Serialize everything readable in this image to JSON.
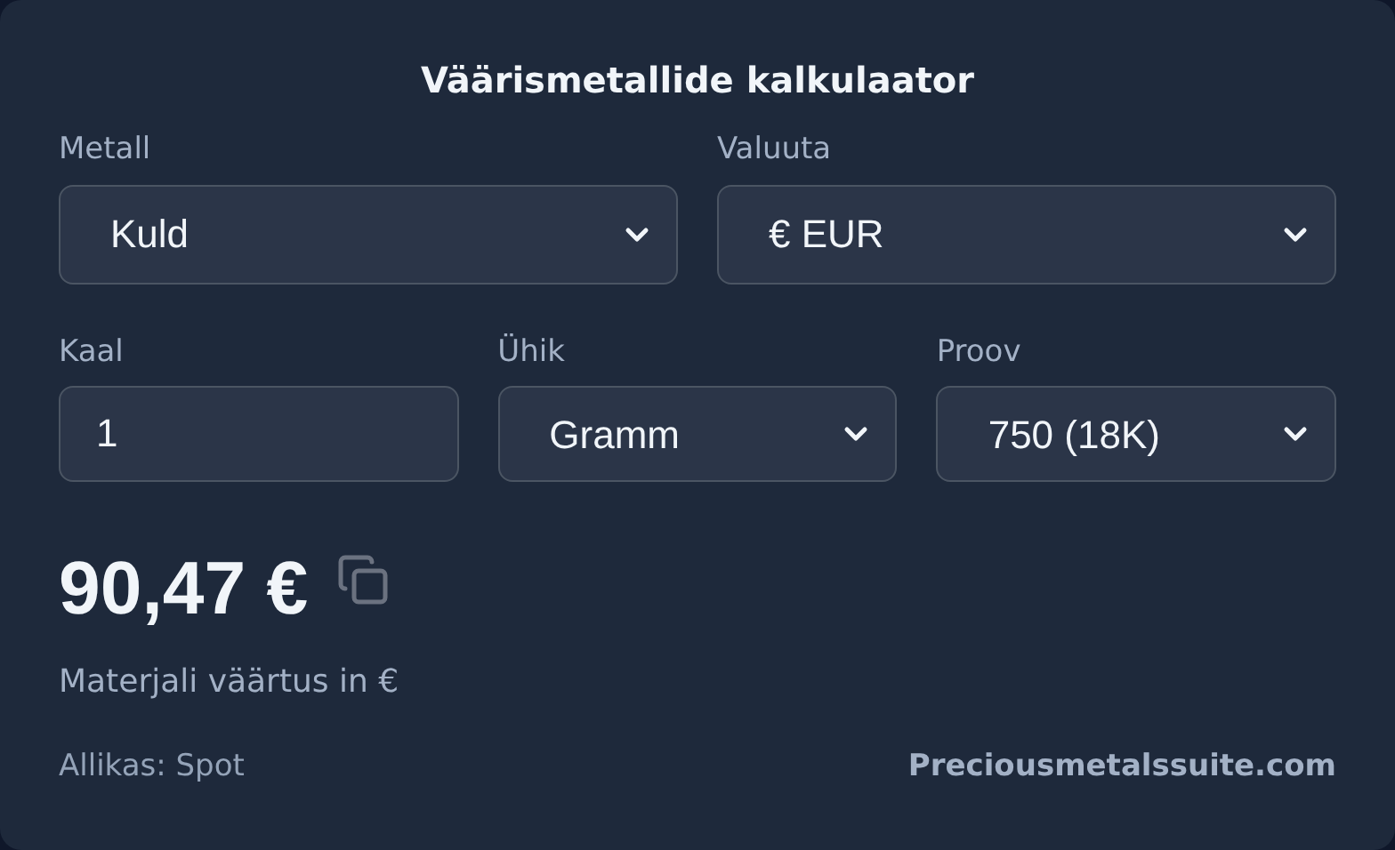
{
  "title": "Väärismetallide kalkulaator",
  "top_fields": [
    {
      "label": "Metall",
      "kind": "select",
      "value": "Kuld"
    },
    {
      "label": "Valuuta",
      "kind": "select",
      "value": "€ EUR"
    }
  ],
  "bottom_fields": [
    {
      "label": "Kaal",
      "kind": "input",
      "value": "1"
    },
    {
      "label": "Ühik",
      "kind": "select",
      "value": "Gramm"
    },
    {
      "label": "Proov",
      "kind": "select",
      "value": "750 (18K)"
    }
  ],
  "result": {
    "price": "90,47 €",
    "caption": "Materjali väärtus in €"
  },
  "footer": {
    "source": "Allikas: Spot",
    "link": "Preciousmetalssuite.com"
  }
}
